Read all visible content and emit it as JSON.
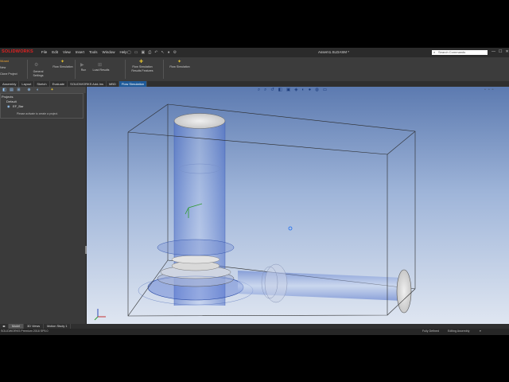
{
  "app": {
    "logo_text": "SOLIDWORKS",
    "menu": [
      "File",
      "Edit",
      "View",
      "Insert",
      "Tools",
      "Window",
      "Help"
    ],
    "document_title": "Assem1.SLDASM *",
    "search_placeholder": "Search Commands",
    "window_controls": [
      "—",
      "☐",
      "✕"
    ]
  },
  "command_manager": {
    "left_labels": [
      "Wizard",
      "New",
      "Clone Project"
    ],
    "items": [
      {
        "label": "General Settings",
        "icon": "settings-icon"
      },
      {
        "label": "Flow Simulation",
        "icon": "flow-icon"
      },
      {
        "label": "Run",
        "icon": "run-icon"
      },
      {
        "label": "Load Results",
        "icon": "load-icon"
      },
      {
        "label": "Flow Simulation Results Features",
        "icon": "results-icon"
      },
      {
        "label": "Flow Simulation",
        "icon": "flow2-icon"
      }
    ]
  },
  "tabs": {
    "items": [
      "Assembly",
      "Layout",
      "Sketch",
      "Evaluate",
      "SOLIDWORKS Add-Ins",
      "MBD",
      "Flow Simulation"
    ],
    "active": "Flow Simulation"
  },
  "panel": {
    "tree": {
      "root": "Projects",
      "child": "Default",
      "leaf": "EF_Bar"
    },
    "hint": "Please activate to create a project."
  },
  "bottom_tabs": {
    "items": [
      "Model",
      "3D Views",
      "Motion Study 1"
    ],
    "active": "Model"
  },
  "status": {
    "left": "SOLIDWORKS Premium 2018 SP5.0",
    "fully_defined": "Fully Defined",
    "editing": "Editing Assembly"
  },
  "colors": {
    "accent": "#1e5a99",
    "brand": "#e02020",
    "viewport_top": "#5c7ab0",
    "viewport_bottom": "#dfe6f1"
  }
}
